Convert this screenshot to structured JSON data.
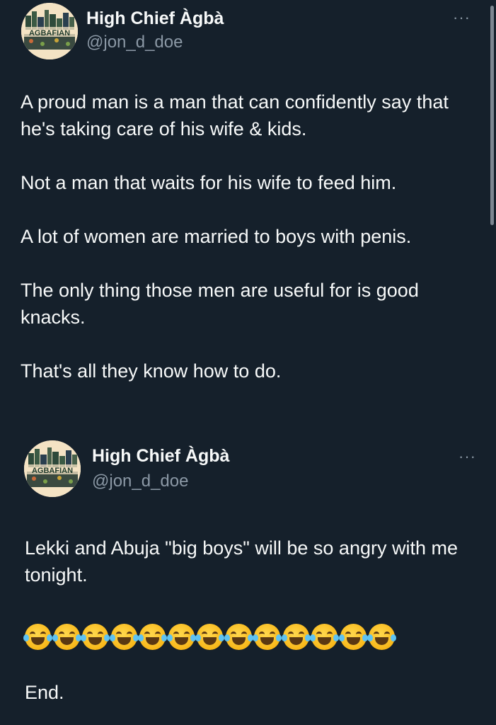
{
  "tweets": [
    {
      "author": {
        "name": "High Chief Àgbà",
        "handle": "@jon_d_doe",
        "avatar_text": "AGBAFIAN"
      },
      "more_label": "···",
      "paragraphs": [
        "A proud man is a man that can confidently say that he's taking care of his wife & kids.",
        "Not a man that waits for his wife to feed him.",
        "A lot of women are married to boys with penis.",
        "The only thing those men are useful for is good knacks.",
        "That's all they know how to do."
      ]
    },
    {
      "author": {
        "name": "High Chief Àgbà",
        "handle": "@jon_d_doe",
        "avatar_text": "AGBAFIAN"
      },
      "more_label": "···",
      "paragraphs": [
        "Lekki and Abuja \"big boys\" will be so angry with me tonight."
      ],
      "emoji_count": 13,
      "emoji_name": "face-with-tears-of-joy",
      "end_text": "End."
    }
  ],
  "colors": {
    "background": "#15202b",
    "text": "#f7f9f9",
    "secondary_text": "#8b98a5"
  }
}
